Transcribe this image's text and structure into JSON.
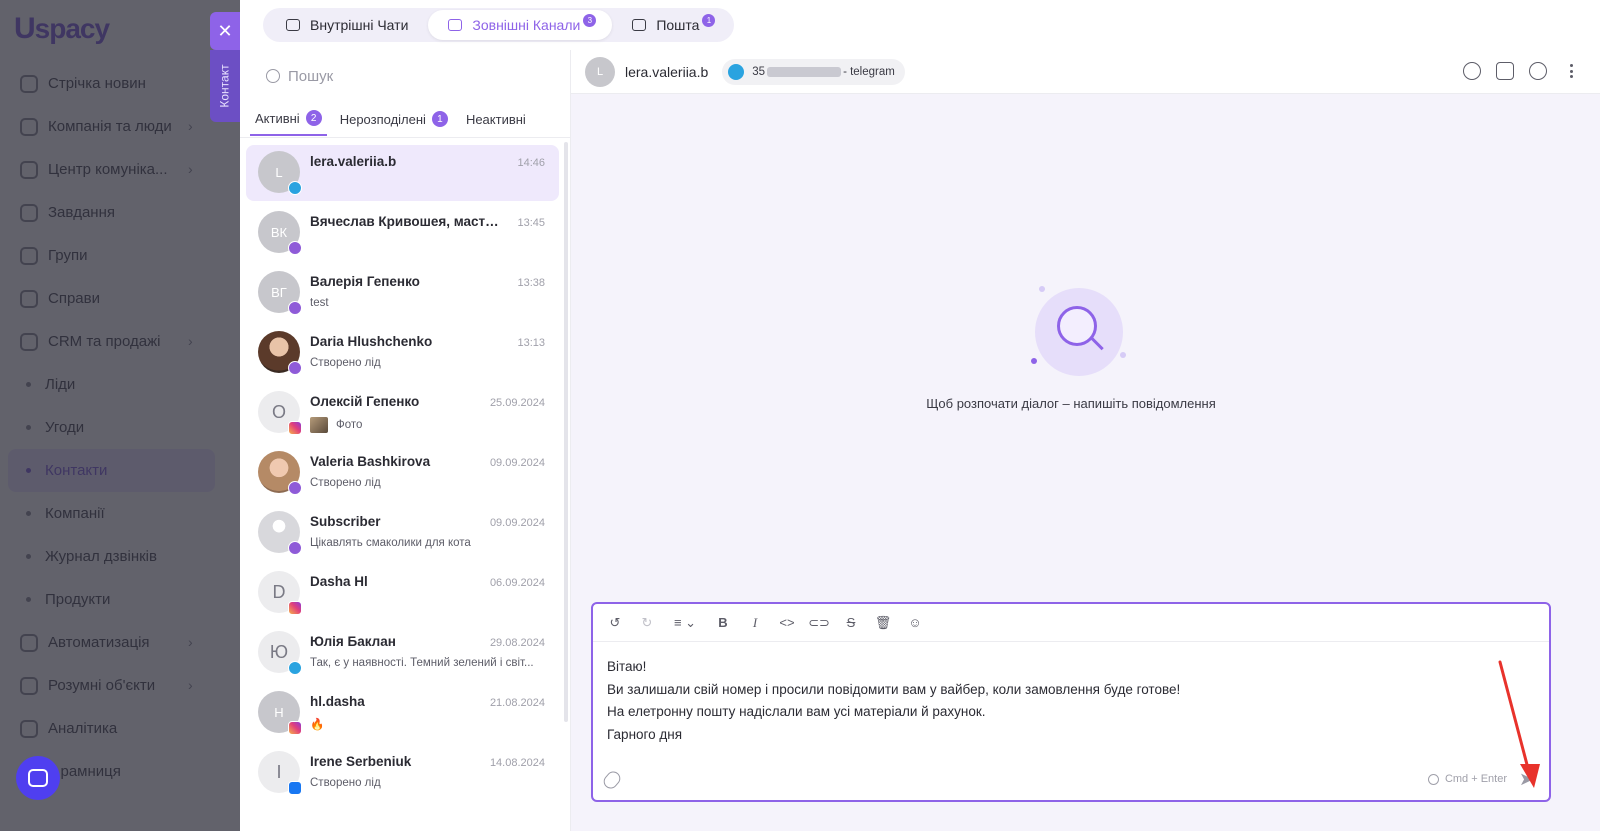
{
  "app": {
    "logo_text": "spacy",
    "logo_letter": "U"
  },
  "bg_nav": [
    {
      "label": "Стрічка новин",
      "type": "item"
    },
    {
      "label": "Компанія та люди",
      "type": "item",
      "arrow": true
    },
    {
      "label": "Центр комуніка...",
      "type": "item",
      "arrow": true
    },
    {
      "label": "Завдання",
      "type": "item"
    },
    {
      "label": "Групи",
      "type": "item"
    },
    {
      "label": "Справи",
      "type": "item"
    },
    {
      "label": "CRM та продажі",
      "type": "item",
      "arrow": true
    },
    {
      "label": "Ліди",
      "type": "sub"
    },
    {
      "label": "Угоди",
      "type": "sub"
    },
    {
      "label": "Контакти",
      "type": "sub",
      "active": true
    },
    {
      "label": "Компанії",
      "type": "sub"
    },
    {
      "label": "Журнал дзвінків",
      "type": "sub"
    },
    {
      "label": "Продукти",
      "type": "sub"
    },
    {
      "label": "Автоматизація",
      "type": "item",
      "arrow": true
    },
    {
      "label": "Розумні об'єкти",
      "type": "item",
      "arrow": true
    },
    {
      "label": "Аналітика",
      "type": "item"
    },
    {
      "label": "...рамниця",
      "type": "item"
    }
  ],
  "side_tab": {
    "close_glyph": "✕",
    "contact_label": "Контакт"
  },
  "channel_tabs": [
    {
      "label": "Внутрішні Чати",
      "icon": "chat-bubble-icon",
      "badge": ""
    },
    {
      "label": "Зовнішні Канали",
      "icon": "channels-icon",
      "badge": "3",
      "active": true
    },
    {
      "label": "Пошта",
      "icon": "mail-icon",
      "badge": "1"
    }
  ],
  "search": {
    "placeholder": "Пошук"
  },
  "list_tabs": [
    {
      "label": "Активні",
      "count": "2",
      "active": true
    },
    {
      "label": "Нерозподілені",
      "count": "1"
    },
    {
      "label": "Неактивні",
      "count": ""
    }
  ],
  "conversations": [
    {
      "initials": "L",
      "name": "lera.valeriia.b",
      "time": "14:46",
      "preview": "",
      "channel": "telegram",
      "selected": true,
      "avatar": "plain"
    },
    {
      "initials": "ВК",
      "name": "Вячеслав Кривошея, мастер...",
      "time": "13:45",
      "preview": "",
      "channel": "viber",
      "avatar": "plain"
    },
    {
      "initials": "ВГ",
      "name": "Валерія Гепенко",
      "time": "13:38",
      "preview": "test",
      "channel": "viber",
      "avatar": "plain"
    },
    {
      "initials": "",
      "name": "Daria Hlushchenko",
      "time": "13:13",
      "preview": "Створено лід",
      "channel": "viber",
      "avatar": "photo1"
    },
    {
      "initials": "О",
      "name": "Олексій Гепенко",
      "time": "25.09.2024",
      "preview": "Фото",
      "channel": "instagram",
      "avatar": "light",
      "thumb": true
    },
    {
      "initials": "",
      "name": "Valeria Bashkirova",
      "time": "09.09.2024",
      "preview": "Створено лід",
      "channel": "viber",
      "avatar": "photo2"
    },
    {
      "initials": "",
      "name": "Subscriber",
      "time": "09.09.2024",
      "preview": "Цікавлять смаколики для кота",
      "channel": "viber",
      "avatar": "photo3"
    },
    {
      "initials": "D",
      "name": "Dasha Hl",
      "time": "06.09.2024",
      "preview": "",
      "channel": "instagram",
      "avatar": "light"
    },
    {
      "initials": "Ю",
      "name": "Юлія Баклан",
      "time": "29.08.2024",
      "preview": "Так, є у наявності. Темний зелений і світ...",
      "channel": "telegram",
      "avatar": "light"
    },
    {
      "initials": "H",
      "name": "hl.dasha",
      "time": "21.08.2024",
      "preview": "🔥",
      "channel": "instagram",
      "avatar": "plain"
    },
    {
      "initials": "I",
      "name": "Irene Serbeniuk",
      "time": "14.08.2024",
      "preview": "Створено лід",
      "channel": "facebook",
      "avatar": "light"
    }
  ],
  "chat_header": {
    "initial": "L",
    "name": "lera.valeriia.b",
    "channel_prefix": "35",
    "channel_suffix": "- telegram"
  },
  "empty_state": {
    "text": "Щоб розпочати діалог – напишіть повідомлення"
  },
  "composer": {
    "lines": [
      "Вітаю!",
      "Ви залишали свій номер і просили повідомити вам у вайбер, коли замовлення буде готове!",
      "На елетронну пошту надіслали вам усі матеріали й рахунок.",
      "Гарного дня"
    ],
    "hint": "Cmd + Enter",
    "toolbar": [
      {
        "name": "undo-icon",
        "glyph": "↺"
      },
      {
        "name": "redo-icon",
        "glyph": "↻",
        "dim": true
      },
      {
        "name": "align-icon",
        "glyph": "≡ ⌄",
        "wide": true
      },
      {
        "name": "bold-icon",
        "glyph": "B"
      },
      {
        "name": "italic-icon",
        "glyph": "I"
      },
      {
        "name": "code-icon",
        "glyph": "<>"
      },
      {
        "name": "link-icon",
        "glyph": "⊂⊃"
      },
      {
        "name": "strikethrough-icon",
        "glyph": "S"
      },
      {
        "name": "trash-icon",
        "glyph": "🗑"
      },
      {
        "name": "emoji-icon",
        "glyph": "☺"
      }
    ]
  },
  "colors": {
    "accent": "#8e63e8",
    "selected_bg": "#efe9fc",
    "chat_bg": "#f5f3fb",
    "annotation_arrow": "#e8322b"
  }
}
